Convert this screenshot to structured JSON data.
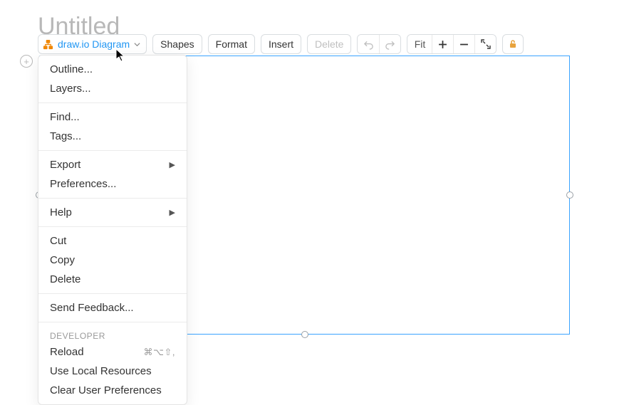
{
  "pageTitle": "Untitled",
  "toolbar": {
    "mainLabel": "draw.io Diagram",
    "shapes": "Shapes",
    "format": "Format",
    "insert": "Insert",
    "delete": "Delete",
    "fit": "Fit"
  },
  "dropdown": {
    "outline": "Outline...",
    "layers": "Layers...",
    "find": "Find...",
    "tags": "Tags...",
    "export": "Export",
    "preferences": "Preferences...",
    "help": "Help",
    "cut": "Cut",
    "copy": "Copy",
    "deleteItem": "Delete",
    "sendFeedback": "Send Feedback...",
    "developerHeader": "DEVELOPER",
    "reload": "Reload",
    "reloadShortcut": "⌘⌥⇧,",
    "useLocal": "Use Local Resources",
    "clearPrefs": "Clear User Preferences"
  }
}
